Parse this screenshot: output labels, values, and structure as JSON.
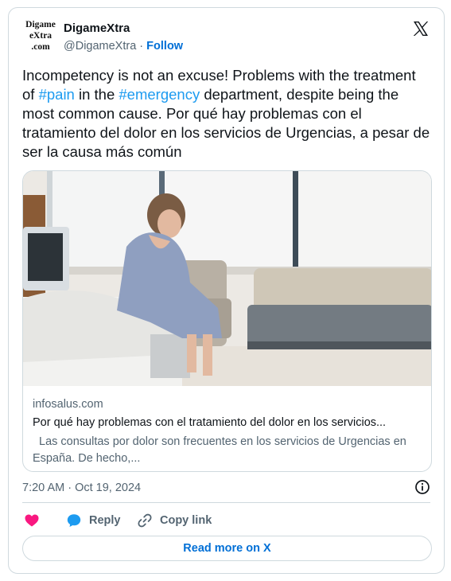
{
  "author": {
    "avatar_lines": [
      "Digame",
      "eXtra",
      ".com"
    ],
    "display_name": "DigameXtra",
    "handle": "@DigameXtra",
    "separator": " · ",
    "follow_label": "Follow"
  },
  "tweet": {
    "segments": [
      {
        "text": "Incompetency is not an excuse! Problems with the treatment of ",
        "hashtag": false
      },
      {
        "text": "#pain",
        "hashtag": true
      },
      {
        "text": " in the ",
        "hashtag": false
      },
      {
        "text": "#emergency",
        "hashtag": true
      },
      {
        "text": " department, despite being the most common cause. Por qué hay problemas con el tratamiento del dolor en los servicios de Urgencias, a pesar de ser la causa más común",
        "hashtag": false
      }
    ]
  },
  "link_card": {
    "domain": "infosalus.com",
    "title": "Por qué hay problemas con el tratamiento del dolor en los servicios...",
    "description": "Las consultas por dolor son frecuentes en los servicios de Urgencias en España. De hecho,..."
  },
  "timestamp": "7:20 AM · Oct 19, 2024",
  "actions": {
    "reply_label": "Reply",
    "copy_link_label": "Copy link"
  },
  "read_more_label": "Read more on X",
  "colors": {
    "link_blue": "#1d9bf0",
    "follow_blue": "#006fd6",
    "heart_red": "#f91880",
    "muted_text": "#536471",
    "border": "#cfd9de"
  }
}
